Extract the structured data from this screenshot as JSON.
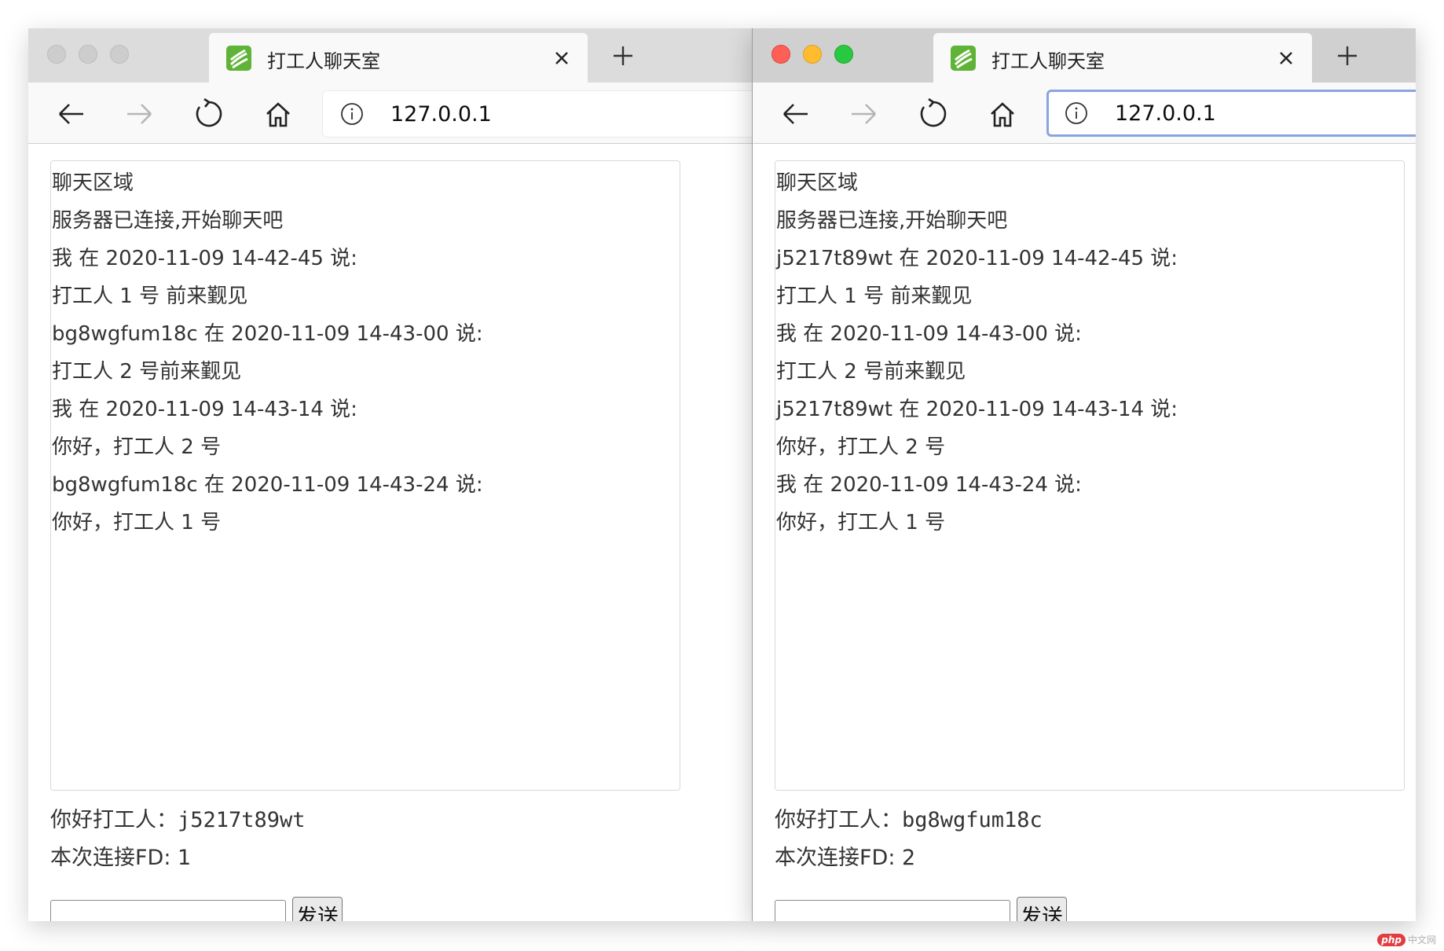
{
  "windows": [
    {
      "tab_title": "打工人聊天室",
      "url": "127.0.0.1",
      "chat": {
        "heading": "聊天区域",
        "lines": [
          "服务器已连接,开始聊天吧",
          "我 在 2020-11-09 14-42-45 说:",
          "打工人 1 号 前来觐见",
          "bg8wgfum18c 在 2020-11-09 14-43-00 说:",
          "打工人 2 号前来觐见",
          "我 在 2020-11-09 14-43-14 说:",
          "你好，打工人 2 号",
          "bg8wgfum18c 在 2020-11-09 14-43-24 说:",
          "你好，打工人 1 号"
        ]
      },
      "greeting_prefix": "你好打工人：",
      "user_id": "j5217t89wt",
      "fd_label": "本次连接FD: 1",
      "input_value": "",
      "send_label": "发送"
    },
    {
      "tab_title": "打工人聊天室",
      "url": "127.0.0.1",
      "chat": {
        "heading": "聊天区域",
        "lines": [
          "服务器已连接,开始聊天吧",
          "j5217t89wt 在 2020-11-09 14-42-45 说:",
          "打工人 1 号 前来觐见",
          "我 在 2020-11-09 14-43-00 说:",
          "打工人 2 号前来觐见",
          "j5217t89wt 在 2020-11-09 14-43-14 说:",
          "你好，打工人 2 号",
          "我 在 2020-11-09 14-43-24 说:",
          "你好，打工人 1 号"
        ]
      },
      "greeting_prefix": "你好打工人：",
      "user_id": "bg8wgfum18c",
      "fd_label": "本次连接FD: 2",
      "input_value": "",
      "send_label": "发送"
    }
  ],
  "watermark": {
    "badge": "php",
    "text": "中文网"
  },
  "colors": {
    "logo_green": "#5fb336",
    "focus_ring": "#8aa4e0",
    "close_red": "#fe5f57",
    "minimize_yellow": "#febc2e",
    "zoom_green": "#28c840"
  },
  "icons": [
    "tab-logo-icon",
    "close-icon",
    "plus-icon",
    "back-arrow-icon",
    "forward-arrow-icon",
    "reload-icon",
    "home-icon",
    "info-icon"
  ]
}
